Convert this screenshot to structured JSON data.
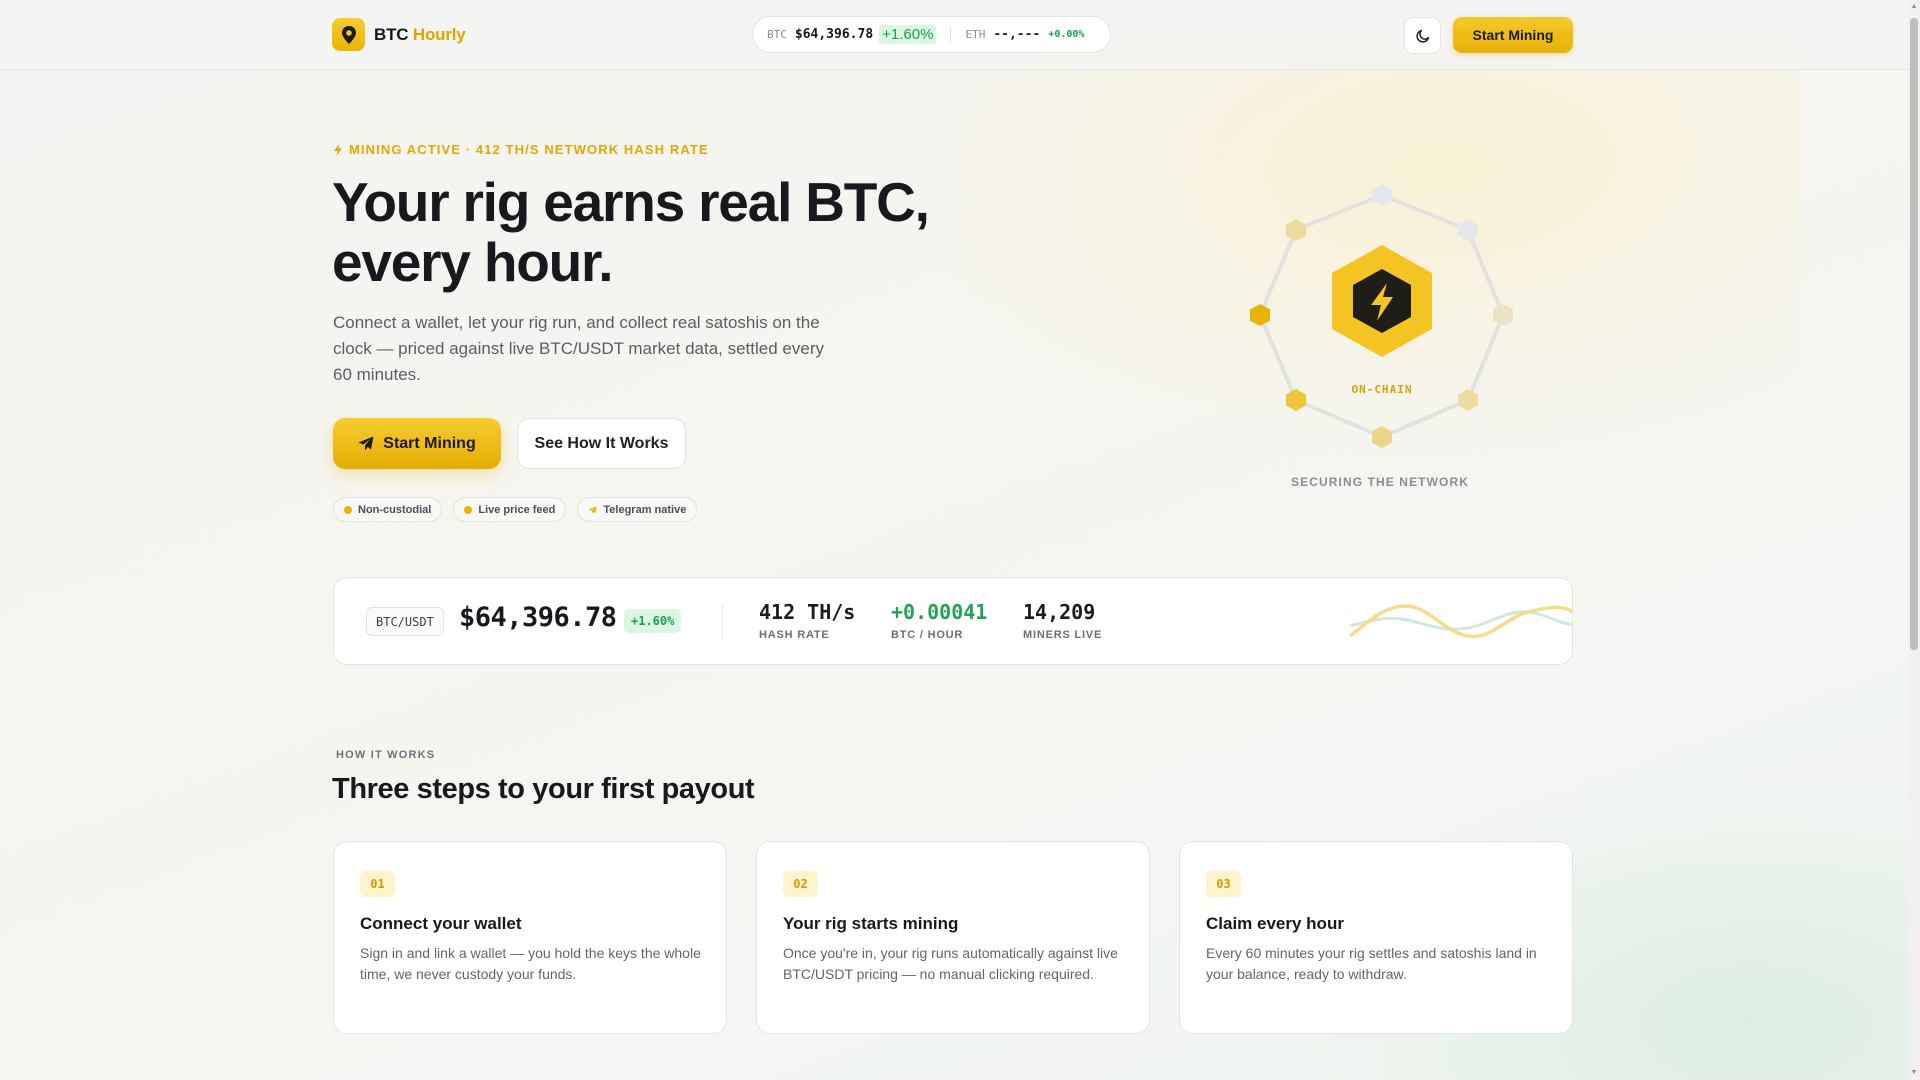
{
  "header": {
    "brand_main": "BTC",
    "brand_accent": "Hourly",
    "ticker": {
      "btc_symbol": "BTC",
      "btc_price": "$64,396.78",
      "btc_change": "+1.60%",
      "eth_symbol": "ETH",
      "eth_price": "--,---",
      "eth_change": "+0.00%"
    },
    "theme_toggle_icon": "moon-icon",
    "cta_label": "Start Mining"
  },
  "hero": {
    "eyebrow": "MINING ACTIVE · 412 TH/S NETWORK HASH RATE",
    "title_line1": "Your rig earns real BTC,",
    "title_line2": "every hour.",
    "subtitle": "Connect a wallet, let your rig run, and collect real satoshis on the clock — priced against live BTC/USDT market data, settled every 60 minutes.",
    "primary_button": "Start Mining",
    "secondary_button": "See How It Works",
    "chips": [
      "Non-custodial",
      "Live price feed",
      "Telegram native"
    ]
  },
  "graphic": {
    "center_label": "ON-CHAIN",
    "caption": "SECURING THE NETWORK"
  },
  "stats": {
    "pair": "BTC/USDT",
    "price": "$64,396.78",
    "change": "+1.60%",
    "hash_rate_value": "412 TH/s",
    "hash_rate_label": "HASH RATE",
    "btc_hour_value": "+0.00041",
    "btc_hour_label": "BTC / HOUR",
    "miners_value": "14,209",
    "miners_label": "MINERS LIVE"
  },
  "how_it_works": {
    "eyebrow": "HOW IT WORKS",
    "title": "Three steps to your first payout",
    "steps": [
      {
        "num": "01",
        "title": "Connect your wallet",
        "body": "Sign in and link a wallet — you hold the keys the whole time, we never custody your funds."
      },
      {
        "num": "02",
        "title": "Your rig starts mining",
        "body": "Once you're in, your rig runs automatically against live BTC/USDT pricing — no manual clicking required."
      },
      {
        "num": "03",
        "title": "Claim every hour",
        "body": "Every 60 minutes your rig settles and satoshis land in your balance, ready to withdraw."
      }
    ]
  },
  "colors": {
    "accent": "#eab308",
    "positive": "#16a34a",
    "text": "#17191e"
  }
}
